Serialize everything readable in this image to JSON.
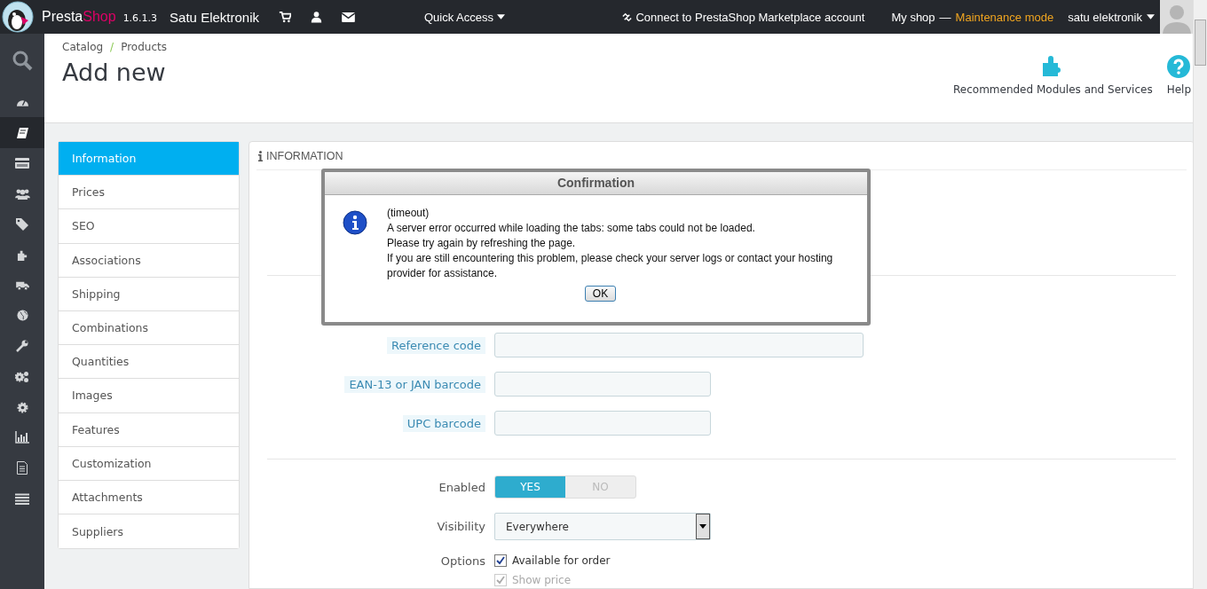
{
  "topbar": {
    "brand_first": "Presta",
    "brand_second": "Shop",
    "version": "1.6.1.3",
    "shop_name": "Satu Elektronik",
    "quick_access": "Quick Access",
    "marketplace": "Connect to PrestaShop Marketplace account",
    "my_shop": "My shop",
    "separator": "—",
    "maintenance": "Maintenance mode",
    "user": "satu elektronik"
  },
  "sidebar": {
    "items": [
      {
        "kind": "search",
        "selected": false
      },
      {
        "kind": "dashboard",
        "selected": false
      },
      {
        "kind": "catalog",
        "selected": true
      },
      {
        "kind": "orders",
        "selected": false
      },
      {
        "kind": "customers",
        "selected": false
      },
      {
        "kind": "tag",
        "selected": false
      },
      {
        "kind": "modules",
        "selected": false
      },
      {
        "kind": "shipping",
        "selected": false
      },
      {
        "kind": "globe",
        "selected": false
      },
      {
        "kind": "wrench",
        "selected": false
      },
      {
        "kind": "gears",
        "selected": false
      },
      {
        "kind": "gear",
        "selected": false
      },
      {
        "kind": "stats",
        "selected": false
      },
      {
        "kind": "document",
        "selected": false
      },
      {
        "kind": "menu",
        "selected": false
      }
    ]
  },
  "header": {
    "breadcrumb": [
      "Catalog",
      "Products"
    ],
    "breadcrumb_separator": "/",
    "title": "Add new",
    "toolbar": [
      {
        "kind": "modules",
        "label": "Recommended Modules and Services"
      },
      {
        "kind": "help",
        "label": "Help"
      }
    ]
  },
  "tabs": [
    {
      "label": "Information",
      "selected": true
    },
    {
      "label": "Prices",
      "selected": false
    },
    {
      "label": "SEO",
      "selected": false
    },
    {
      "label": "Associations",
      "selected": false
    },
    {
      "label": "Shipping",
      "selected": false
    },
    {
      "label": "Combinations",
      "selected": false
    },
    {
      "label": "Quantities",
      "selected": false
    },
    {
      "label": "Images",
      "selected": false
    },
    {
      "label": "Features",
      "selected": false
    },
    {
      "label": "Customization",
      "selected": false
    },
    {
      "label": "Attachments",
      "selected": false
    },
    {
      "label": "Suppliers",
      "selected": false
    }
  ],
  "panel": {
    "heading": "INFORMATION",
    "code_fields": [
      {
        "label": "Reference code",
        "wide": true
      },
      {
        "label": "EAN-13 or JAN barcode",
        "wide": false
      },
      {
        "label": "UPC barcode",
        "wide": false
      }
    ],
    "enabled": {
      "label": "Enabled",
      "yes": "YES",
      "no": "NO",
      "on": true
    },
    "visibility": {
      "label": "Visibility",
      "value": "Everywhere"
    },
    "options": {
      "label": "Options",
      "items": [
        {
          "label": "Available for order",
          "checked": true,
          "disabled": false
        },
        {
          "label": "Show price",
          "checked": true,
          "disabled": true
        }
      ]
    }
  },
  "dialog": {
    "title": "Confirmation",
    "lines": [
      "(timeout)",
      "A server error occurred while loading the tabs: some tabs could not be loaded.",
      "Please try again by refreshing the page.",
      "If you are still encountering this problem, please check your server logs or contact your hosting provider for assistance."
    ],
    "button": "OK"
  }
}
